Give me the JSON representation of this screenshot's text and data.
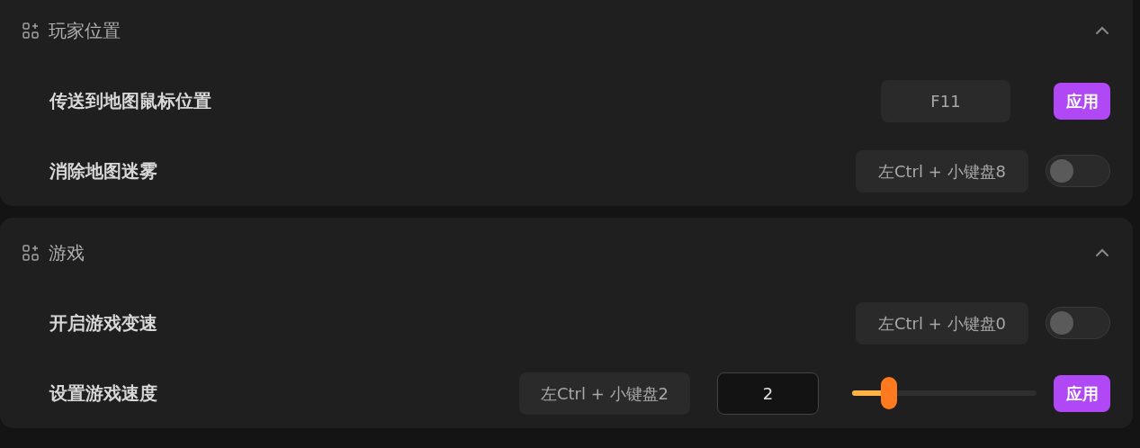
{
  "sections": [
    {
      "title": "玩家位置",
      "expanded": true,
      "rows": [
        {
          "kind": "apply",
          "label": "传送到地图鼠标位置",
          "hotkey": "F11",
          "button": "应用"
        },
        {
          "kind": "toggle",
          "label": "消除地图迷雾",
          "hotkey": "左Ctrl + 小键盘8",
          "on": false
        }
      ]
    },
    {
      "title": "游戏",
      "expanded": true,
      "rows": [
        {
          "kind": "toggle",
          "label": "开启游戏变速",
          "hotkey": "左Ctrl + 小键盘0",
          "on": false
        },
        {
          "kind": "speed",
          "label": "设置游戏速度",
          "hotkey": "左Ctrl + 小键盘2",
          "value": "2",
          "level": 0.2,
          "button": "应用"
        }
      ]
    }
  ]
}
